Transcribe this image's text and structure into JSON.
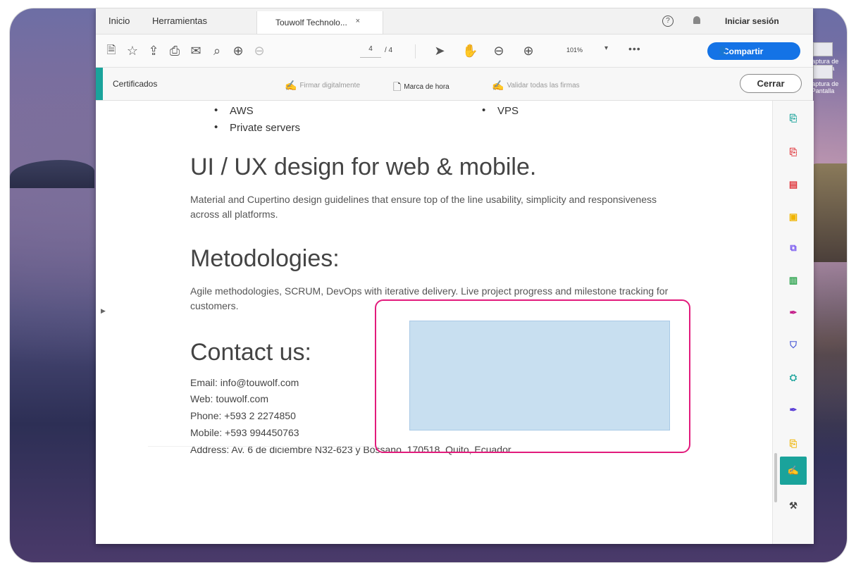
{
  "window": {
    "home_tab": "Inicio",
    "tools_tab": "Herramientas",
    "doc_tab": "Touwolf Technolo...",
    "doc_tab_close": "×",
    "help": "?",
    "signin": "Iniciar sesión"
  },
  "toolbar": {
    "page_current": "4",
    "page_total": "/ 4",
    "zoom": "101%",
    "zoom_caret": "▾",
    "more": "•••",
    "share_label": "Compartir"
  },
  "certbar": {
    "label": "Certificados",
    "sign_digitally": "Firmar digitalmente",
    "timestamp": "Marca de hora",
    "validate_all": "Validar todas las firmas",
    "close_label": "Cerrar"
  },
  "document": {
    "bullets_left": [
      "AWS",
      "Private servers"
    ],
    "bullets_right": [
      "VPS"
    ],
    "section_ui_title": "UI / UX design for web & mobile.",
    "section_ui_text": "Material and Cupertino design guidelines that ensure top of the line usability, simplicity and responsiveness across all platforms.",
    "section_method_title": "Metodologies:",
    "section_method_text": "Agile methodologies, SCRUM, DevOps with iterative delivery. Live project progress and milestone tracking for customers.",
    "section_contact_title": "Contact us:",
    "contact": {
      "email": "Email: info@touwolf.com",
      "web": "Web: touwolf.com",
      "phone": "Phone: +593 2 2274850",
      "mobile": "Mobile: +593 994450763",
      "address": "Address: Av. 6 de diciembre N32-623 y Bossano. 170518. Quito, Ecuador"
    }
  },
  "desktop": {
    "icon1_label": "Captura de Pantalla",
    "icon2_label": "Captura de Pantalla"
  },
  "colors": {
    "accent_teal": "#1aa39b",
    "share_blue": "#1473e6",
    "highlight_pink": "#e21b7c",
    "signature_box": "#c8dff0"
  }
}
